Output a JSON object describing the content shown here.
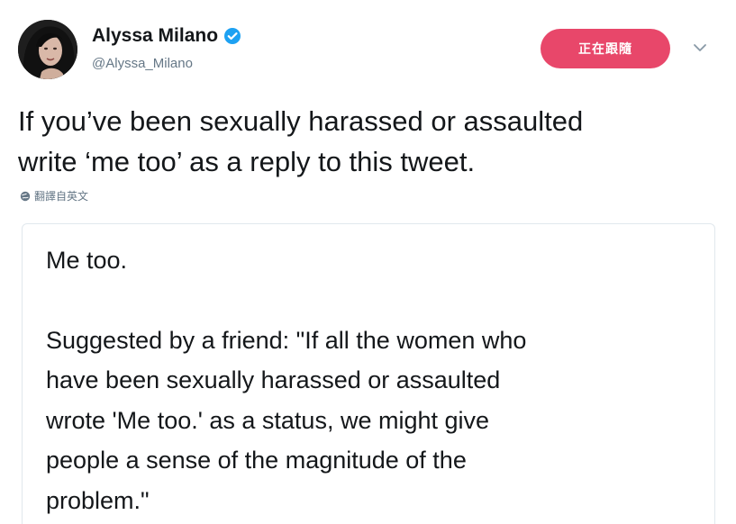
{
  "tweet": {
    "author": {
      "display_name": "Alyssa Milano",
      "handle": "@Alyssa_Milano",
      "verified": true
    },
    "follow_button_label": "正在跟隨",
    "text_lines": [
      "If you’ve been sexually harassed or assaulted",
      "write ‘me too’ as a reply to this tweet."
    ],
    "translate_label": "翻譯自英文",
    "quote": {
      "first_line": "Me too.",
      "body_lines": [
        "Suggested by a friend: \"If all the women who",
        "have been sexually harassed or assaulted",
        "wrote 'Me too.' as a status, we might give",
        "people a sense of the magnitude of the",
        "problem.\""
      ]
    }
  },
  "icons": {
    "verified": "verified-badge-icon",
    "more": "chevron-down-icon",
    "translate": "globe-icon",
    "avatar": "profile-photo"
  },
  "colors": {
    "follow_button": "#e8476a",
    "verified_badge": "#1da1f2",
    "secondary_text": "#657786",
    "primary_text": "#14171a",
    "card_border": "#e1e8ed"
  }
}
